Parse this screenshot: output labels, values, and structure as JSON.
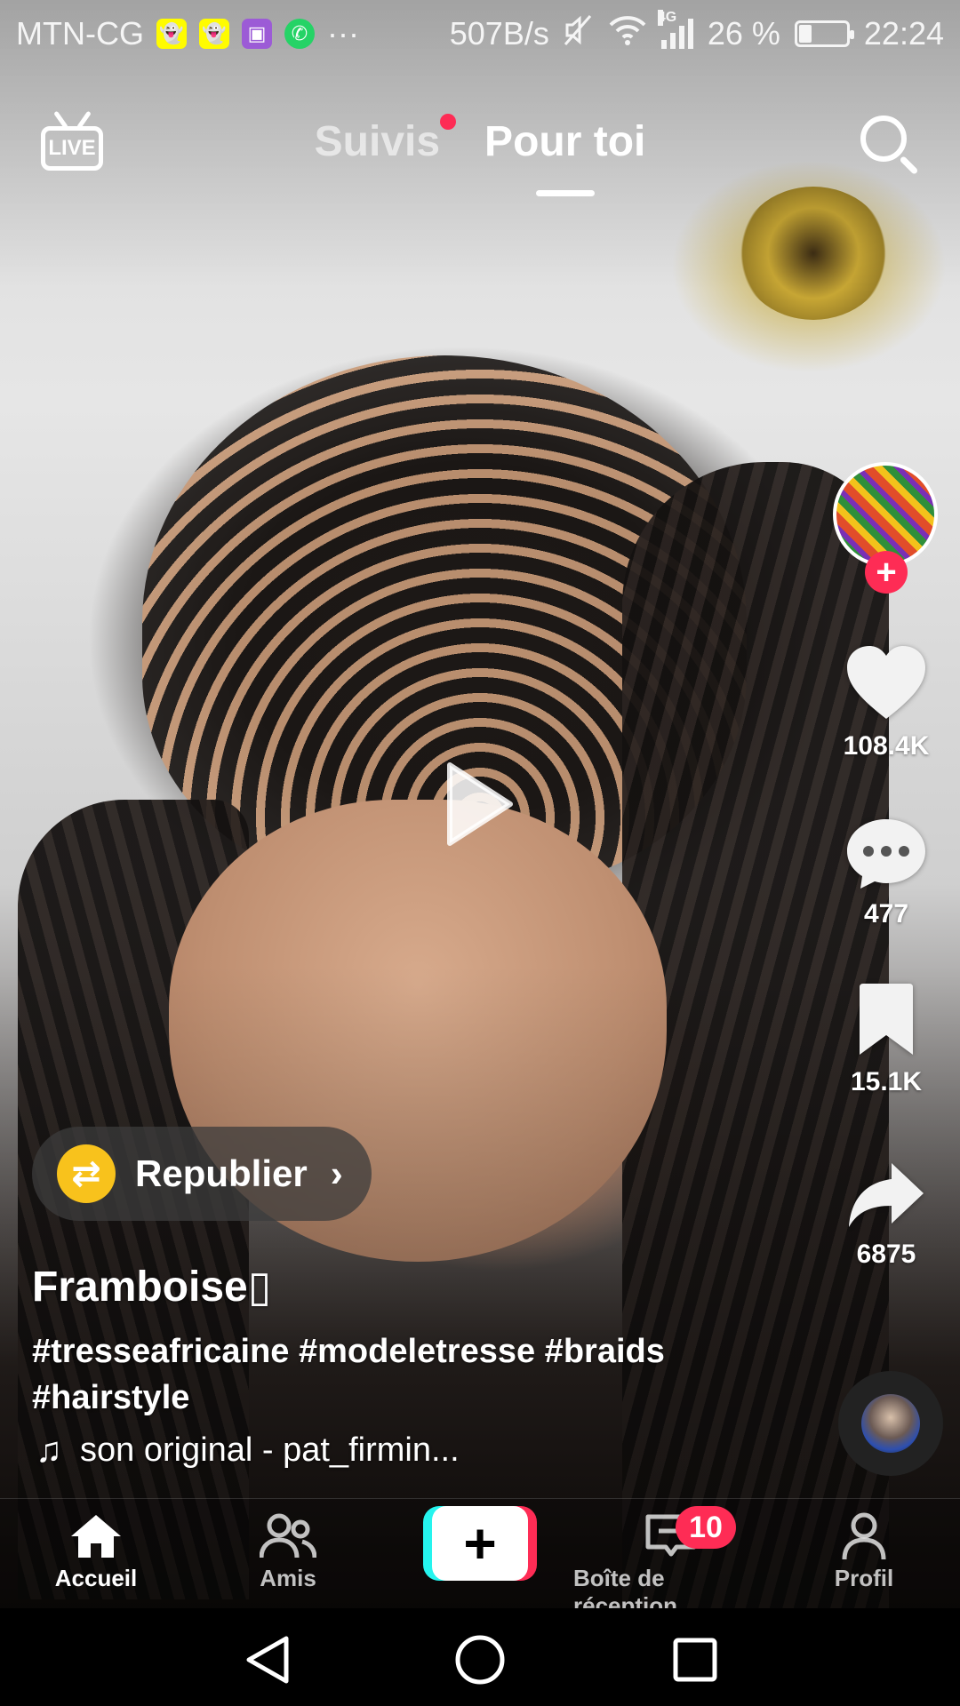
{
  "status_bar": {
    "carrier": "MTN-CG",
    "overflow": "···",
    "net_speed": "507B/s",
    "network_type": "4G",
    "battery_text": "26 %",
    "battery_level": 0.26,
    "time": "22:24",
    "app_icons": [
      "snapchat-icon",
      "snapchat-icon",
      "gallery-icon",
      "whatsapp-icon"
    ]
  },
  "header": {
    "live_label": "LIVE",
    "tabs": [
      {
        "label": "Suivis",
        "active": false,
        "has_dot": true
      },
      {
        "label": "Pour toi",
        "active": true
      }
    ]
  },
  "rail": {
    "likes": "108.4K",
    "comments": "477",
    "saves": "15.1K",
    "shares": "6875"
  },
  "repost": {
    "label": "Republier"
  },
  "caption": {
    "username": "Framboise▯",
    "hashtags": "#tresseafricaine #modeletresse #braids #hairstyle",
    "sound": "son original - pat_firmin..."
  },
  "bottom_nav": {
    "items": [
      {
        "label": "Accueil",
        "active": true
      },
      {
        "label": "Amis",
        "active": false
      },
      {
        "label": "Boîte de réception",
        "active": false,
        "badge": "10"
      },
      {
        "label": "Profil",
        "active": false
      }
    ]
  },
  "colors": {
    "accent": "#fe2c55",
    "create_cyan": "#25f4ee",
    "repost_yellow": "#f8c21c"
  }
}
